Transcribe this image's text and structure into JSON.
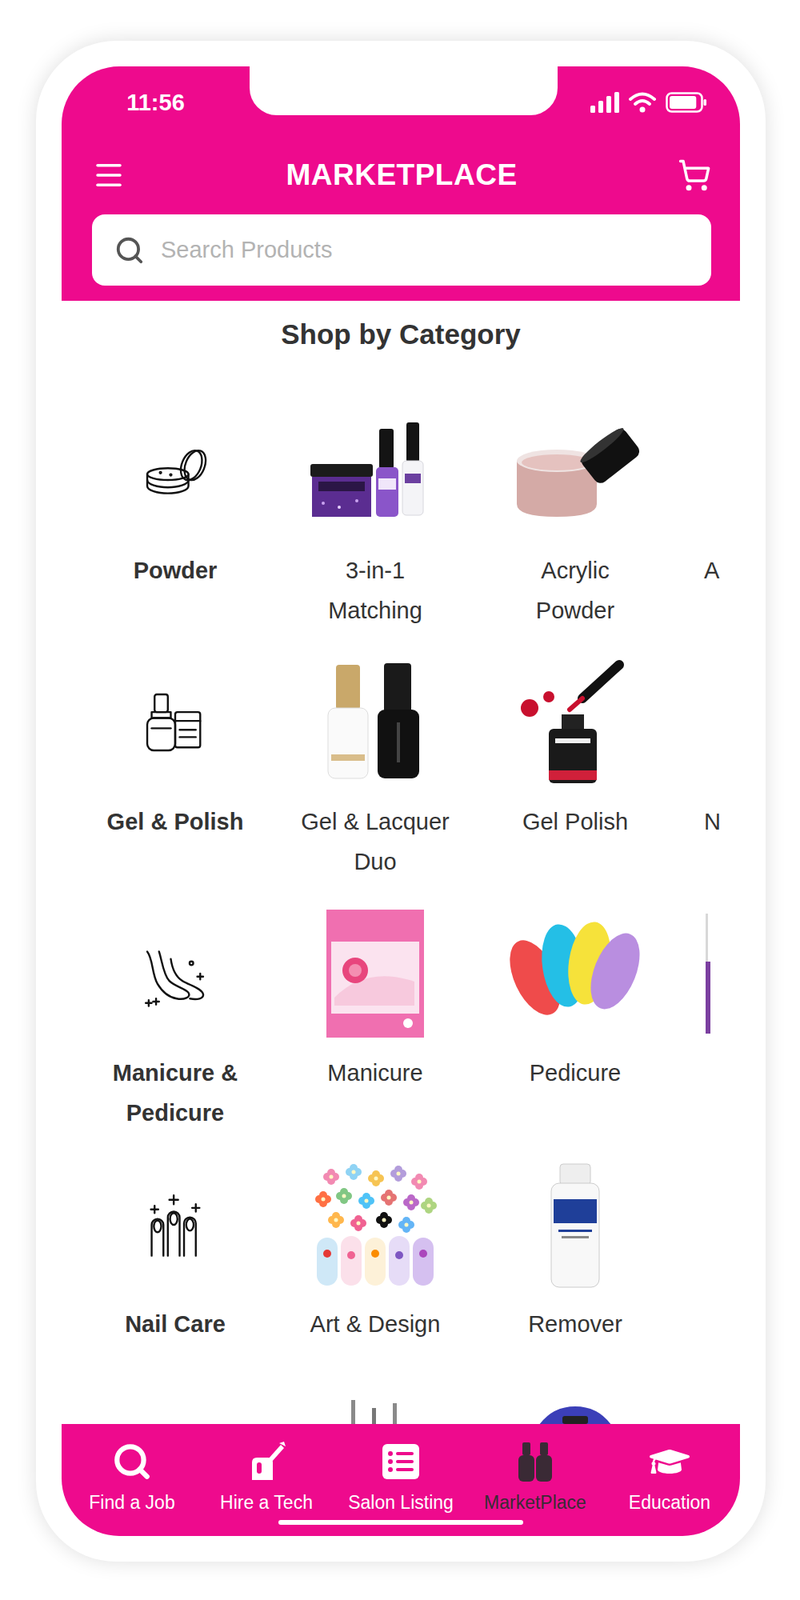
{
  "status_bar": {
    "time": "11:56",
    "battery": {
      "level": 0.9
    }
  },
  "header": {
    "title": "MARKETPLACE"
  },
  "search": {
    "placeholder": "Search Products"
  },
  "section_title": "Shop by Category",
  "category_rows": [
    {
      "items": [
        {
          "kind": "icon",
          "lines": [
            "Powder"
          ]
        },
        {
          "kind": "photo",
          "lines": [
            "3-in-1",
            "Matching"
          ]
        },
        {
          "kind": "photo",
          "lines": [
            "Acrylic",
            "Powder"
          ]
        },
        {
          "kind": "peek",
          "lines": [
            "A"
          ]
        }
      ]
    },
    {
      "items": [
        {
          "kind": "icon",
          "lines": [
            "Gel & Polish"
          ]
        },
        {
          "kind": "photo",
          "lines": [
            "Gel & Lacquer",
            "Duo"
          ]
        },
        {
          "kind": "photo",
          "lines": [
            "Gel Polish"
          ]
        },
        {
          "kind": "peek",
          "lines": [
            "N"
          ]
        }
      ]
    },
    {
      "items": [
        {
          "kind": "icon",
          "lines": [
            "Manicure &",
            "Pedicure"
          ]
        },
        {
          "kind": "photo",
          "lines": [
            "Manicure"
          ]
        },
        {
          "kind": "photo",
          "lines": [
            "Pedicure"
          ]
        },
        {
          "kind": "peek",
          "lines": []
        }
      ]
    },
    {
      "items": [
        {
          "kind": "icon",
          "lines": [
            "Nail Care"
          ]
        },
        {
          "kind": "photo",
          "lines": [
            "Art & Design"
          ]
        },
        {
          "kind": "photo",
          "lines": [
            "Remover"
          ]
        }
      ]
    },
    {
      "items": [
        {
          "kind": "icon",
          "lines": []
        },
        {
          "kind": "photo",
          "lines": []
        },
        {
          "kind": "photo",
          "lines": []
        }
      ]
    }
  ],
  "bottom_nav": [
    {
      "label": "Find a Job",
      "selected": false
    },
    {
      "label": "Hire a Tech",
      "selected": false
    },
    {
      "label": "Salon Listing",
      "selected": false
    },
    {
      "label": "MarketPlace",
      "selected": true
    },
    {
      "label": "Education",
      "selected": false
    }
  ]
}
